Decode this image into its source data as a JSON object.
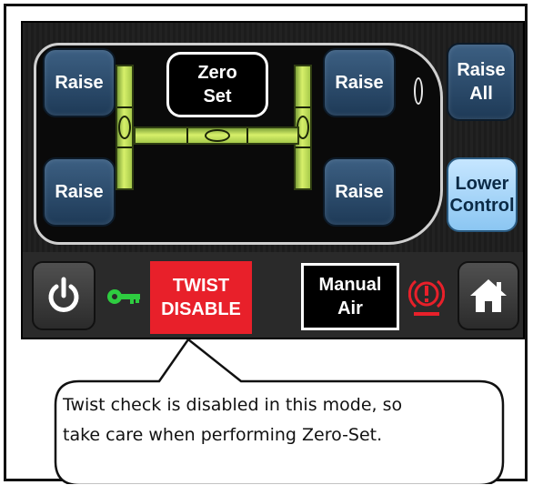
{
  "leveling_panel": {
    "raise_front_left": "Raise",
    "raise_rear_left": "Raise",
    "raise_front_right": "Raise",
    "raise_rear_right": "Raise",
    "zero_set_line1": "Zero",
    "zero_set_line2": "Set",
    "raise_all_line1": "Raise",
    "raise_all_line2": "All",
    "lower_control_line1": "Lower",
    "lower_control_line2": "Control"
  },
  "bottom_bar": {
    "power_icon": "power-icon",
    "key_icon": "key-icon",
    "twist_line1": "TWIST",
    "twist_line2": "DISABLE",
    "manual_air_line1": "Manual",
    "manual_air_line2": "Air",
    "brake_icon": "parking-brake-warning-icon",
    "home_icon": "home-icon"
  },
  "callout": {
    "line1": "Twist check is disabled in this mode, so",
    "line2": "take care when performing Zero-Set."
  },
  "colors": {
    "button_dark": "#2c4d6e",
    "button_light": "#a9d6f7",
    "twist_red": "#e8202a",
    "vial_green": "#c7e35a",
    "key_green": "#2ecc40"
  }
}
